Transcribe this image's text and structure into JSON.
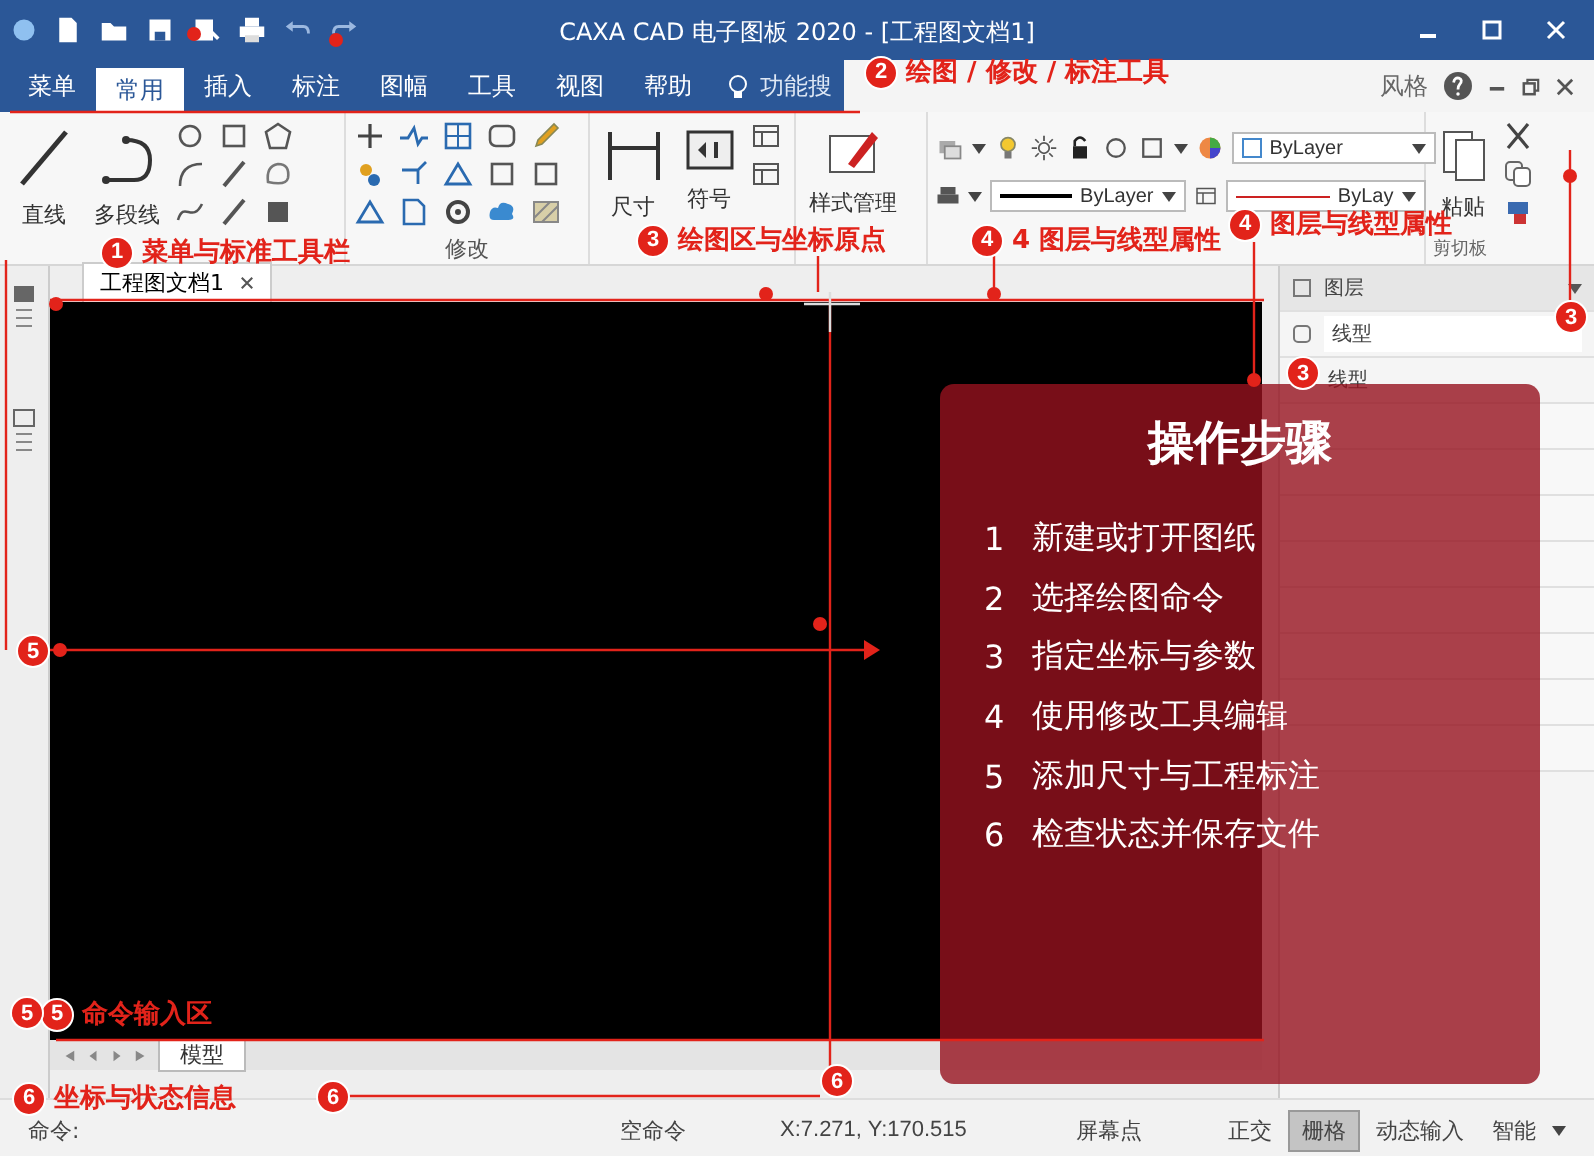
{
  "window": {
    "title": "CAXA CAD 电子图板 2020 - [工程图文档1]"
  },
  "ribbon_tabs": [
    {
      "label": "菜单",
      "selected": false
    },
    {
      "label": "常用",
      "selected": true
    },
    {
      "label": "插入",
      "selected": false
    },
    {
      "label": "标注",
      "selected": false
    },
    {
      "label": "图幅",
      "selected": false
    },
    {
      "label": "工具",
      "selected": false
    },
    {
      "label": "视图",
      "selected": false
    },
    {
      "label": "帮助",
      "selected": false
    }
  ],
  "search": {
    "placeholder": "功能搜"
  },
  "style_menu": {
    "label": "风格"
  },
  "ribbon": {
    "draw": {
      "buttons": [
        "直线",
        "多段线"
      ]
    },
    "modify": {
      "label": "修改"
    },
    "annotate": {
      "buttons": [
        "尺寸",
        "符号"
      ]
    },
    "style": {
      "button": "样式管理"
    },
    "properties": {
      "paint_setting": "ByLayer",
      "linetype": "ByLayer",
      "lineweight": "ByLay"
    },
    "clipboard": {
      "button": "粘贴",
      "label": "剪切板"
    }
  },
  "document_tab": {
    "label": "工程图文档1"
  },
  "properties_panel": {
    "rows": [
      {
        "kind": "header",
        "label": "图层"
      },
      {
        "kind": "dropdown",
        "label": "线型"
      },
      {
        "kind": "plain",
        "label": "线型"
      }
    ]
  },
  "steps_panel": {
    "title": "操作步骤",
    "steps": [
      {
        "number": "1",
        "text": "新建或打开图纸"
      },
      {
        "number": "2",
        "text": "选择绘图命令"
      },
      {
        "number": "3",
        "text": "指定坐标与参数"
      },
      {
        "number": "4",
        "text": "使用修改工具编辑"
      },
      {
        "number": "5",
        "text": "添加尺寸与工程标注"
      },
      {
        "number": "6",
        "text": "检查状态并保存文件"
      }
    ]
  },
  "callouts": [
    {
      "number": "1",
      "text": "菜单与标准工具栏"
    },
    {
      "number": "2",
      "text": "绘图 / 修改 / 标注工具"
    },
    {
      "number": "3",
      "text": "绘图区与坐标原点"
    },
    {
      "number": "4",
      "text": "4 图层与线型属性"
    },
    {
      "number": "4",
      "text": "图层与线型属性"
    },
    {
      "number": "5",
      "text": "命令输入区"
    },
    {
      "number": "6",
      "text": "坐标与状态信息"
    }
  ],
  "markers": [
    {
      "number": "3"
    },
    {
      "number": "3"
    },
    {
      "number": "5"
    },
    {
      "number": "5"
    },
    {
      "number": "6"
    },
    {
      "number": "6"
    }
  ],
  "layout_tabs": [
    {
      "label": "模型",
      "selected": true
    }
  ],
  "status_bar": {
    "prompt": "命令:",
    "command": "空命令",
    "coordinates": "X:7.271, Y:170.515",
    "snap": "屏幕点",
    "toggles": [
      {
        "label": "正交",
        "selected": false
      },
      {
        "label": "栅格",
        "selected": true
      },
      {
        "label": "动态输入",
        "selected": false
      },
      {
        "label": "智能",
        "selected": false
      }
    ]
  }
}
